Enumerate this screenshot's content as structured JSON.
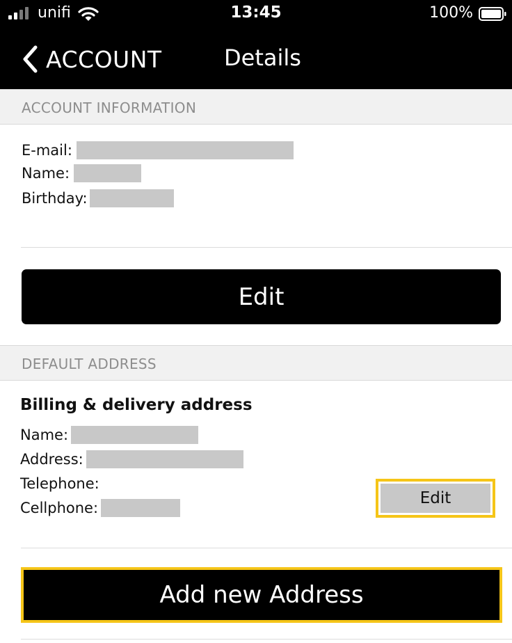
{
  "status_bar": {
    "carrier": "unifi",
    "time": "13:45",
    "battery": "100%",
    "signal_bars_active": 2,
    "signal_bars_total": 4
  },
  "nav": {
    "back_label": "ACCOUNT",
    "title": "Details"
  },
  "account_section": {
    "header": "ACCOUNT INFORMATION",
    "email_label": "E-mail:",
    "name_label": "Name:",
    "birthday_label": "Birthday:",
    "edit_label": "Edit"
  },
  "address_section": {
    "header": "DEFAULT ADDRESS",
    "subheading": "Billing & delivery address",
    "name_label": "Name:",
    "address_label": "Address:",
    "telephone_label": "Telephone:",
    "cellphone_label": "Cellphone:",
    "edit_label": "Edit",
    "add_label": "Add new Address"
  },
  "colors": {
    "highlight": "#f5c518",
    "redaction": "#c8c8c8",
    "header_bg": "#f1f1f1"
  }
}
